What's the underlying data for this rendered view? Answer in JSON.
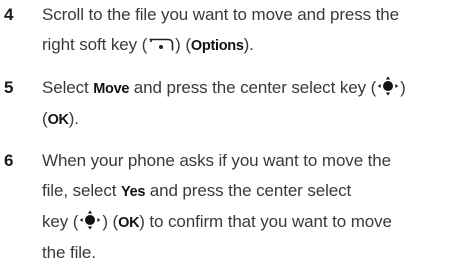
{
  "steps": [
    {
      "number": "4",
      "line1": "Scroll to the file you want to move and press the",
      "line2_a": "right soft key (",
      "line2_b": ") (",
      "line2_bold": "Options",
      "line2_c": ").",
      "icon": "right-soft-key-icon"
    },
    {
      "number": "5",
      "line1_a": "Select ",
      "line1_bold": "Move",
      "line1_b": " and press the center select key (",
      "line1_c": ")",
      "line2_a": "(",
      "line2_bold": "OK",
      "line2_b": ").",
      "icon": "center-select-key-icon"
    },
    {
      "number": "6",
      "line1": "When your phone asks if you want to move the",
      "line2_a": "file, select ",
      "line2_bold": "Yes",
      "line2_b": " and press the center select",
      "line3_a": "key (",
      "line3_b": ") (",
      "line3_bold": "OK",
      "line3_c": ") to confirm that you want to move",
      "line4": "the file.",
      "icon": "center-select-key-icon"
    }
  ]
}
